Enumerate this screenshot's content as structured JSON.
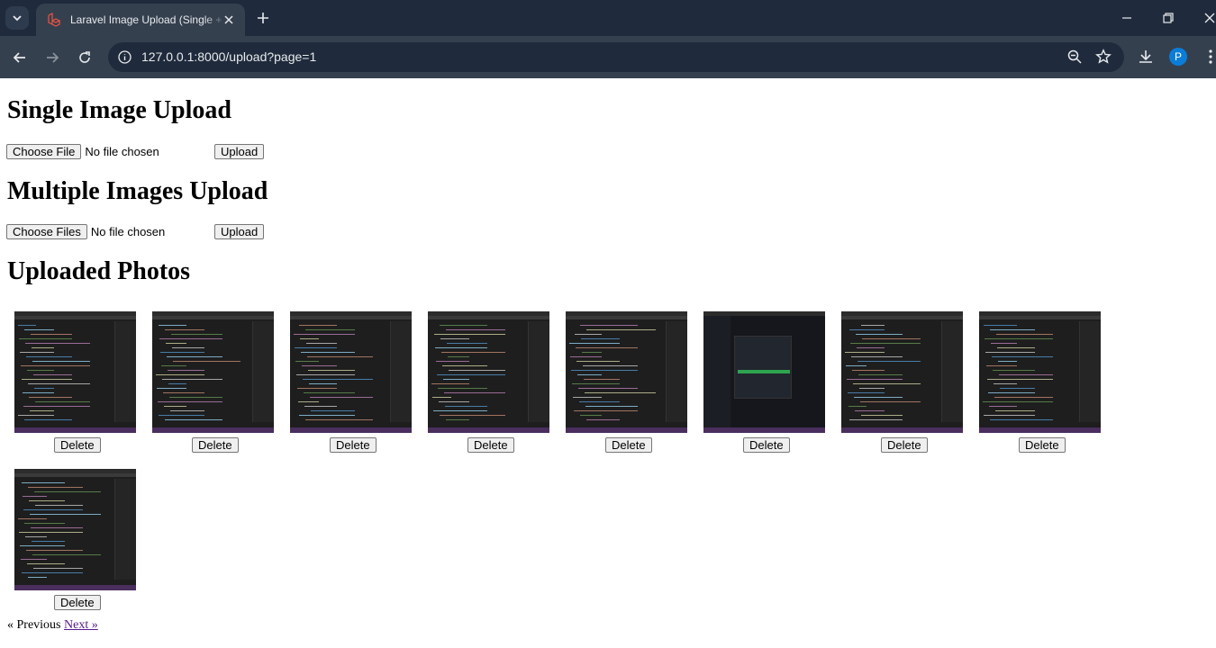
{
  "browser": {
    "tab_title": "Laravel Image Upload (Single + Multiple)",
    "url": "127.0.0.1:8000/upload?page=1",
    "profile_initial": "P"
  },
  "page": {
    "single_heading": "Single Image Upload",
    "single_choose_label": "Choose File",
    "single_status": "No file chosen",
    "single_upload_label": "Upload",
    "multi_heading": "Multiple Images Upload",
    "multi_choose_label": "Choose Files",
    "multi_status": "No file chosen",
    "multi_upload_label": "Upload",
    "photos_heading": "Uploaded Photos",
    "delete_label": "Delete",
    "photos": [
      {
        "style": "code"
      },
      {
        "style": "code"
      },
      {
        "style": "code"
      },
      {
        "style": "code"
      },
      {
        "style": "code"
      },
      {
        "style": "login"
      },
      {
        "style": "code"
      },
      {
        "style": "code"
      },
      {
        "style": "code"
      }
    ]
  },
  "pagination": {
    "previous_label": "« Previous",
    "next_label": "Next »"
  }
}
